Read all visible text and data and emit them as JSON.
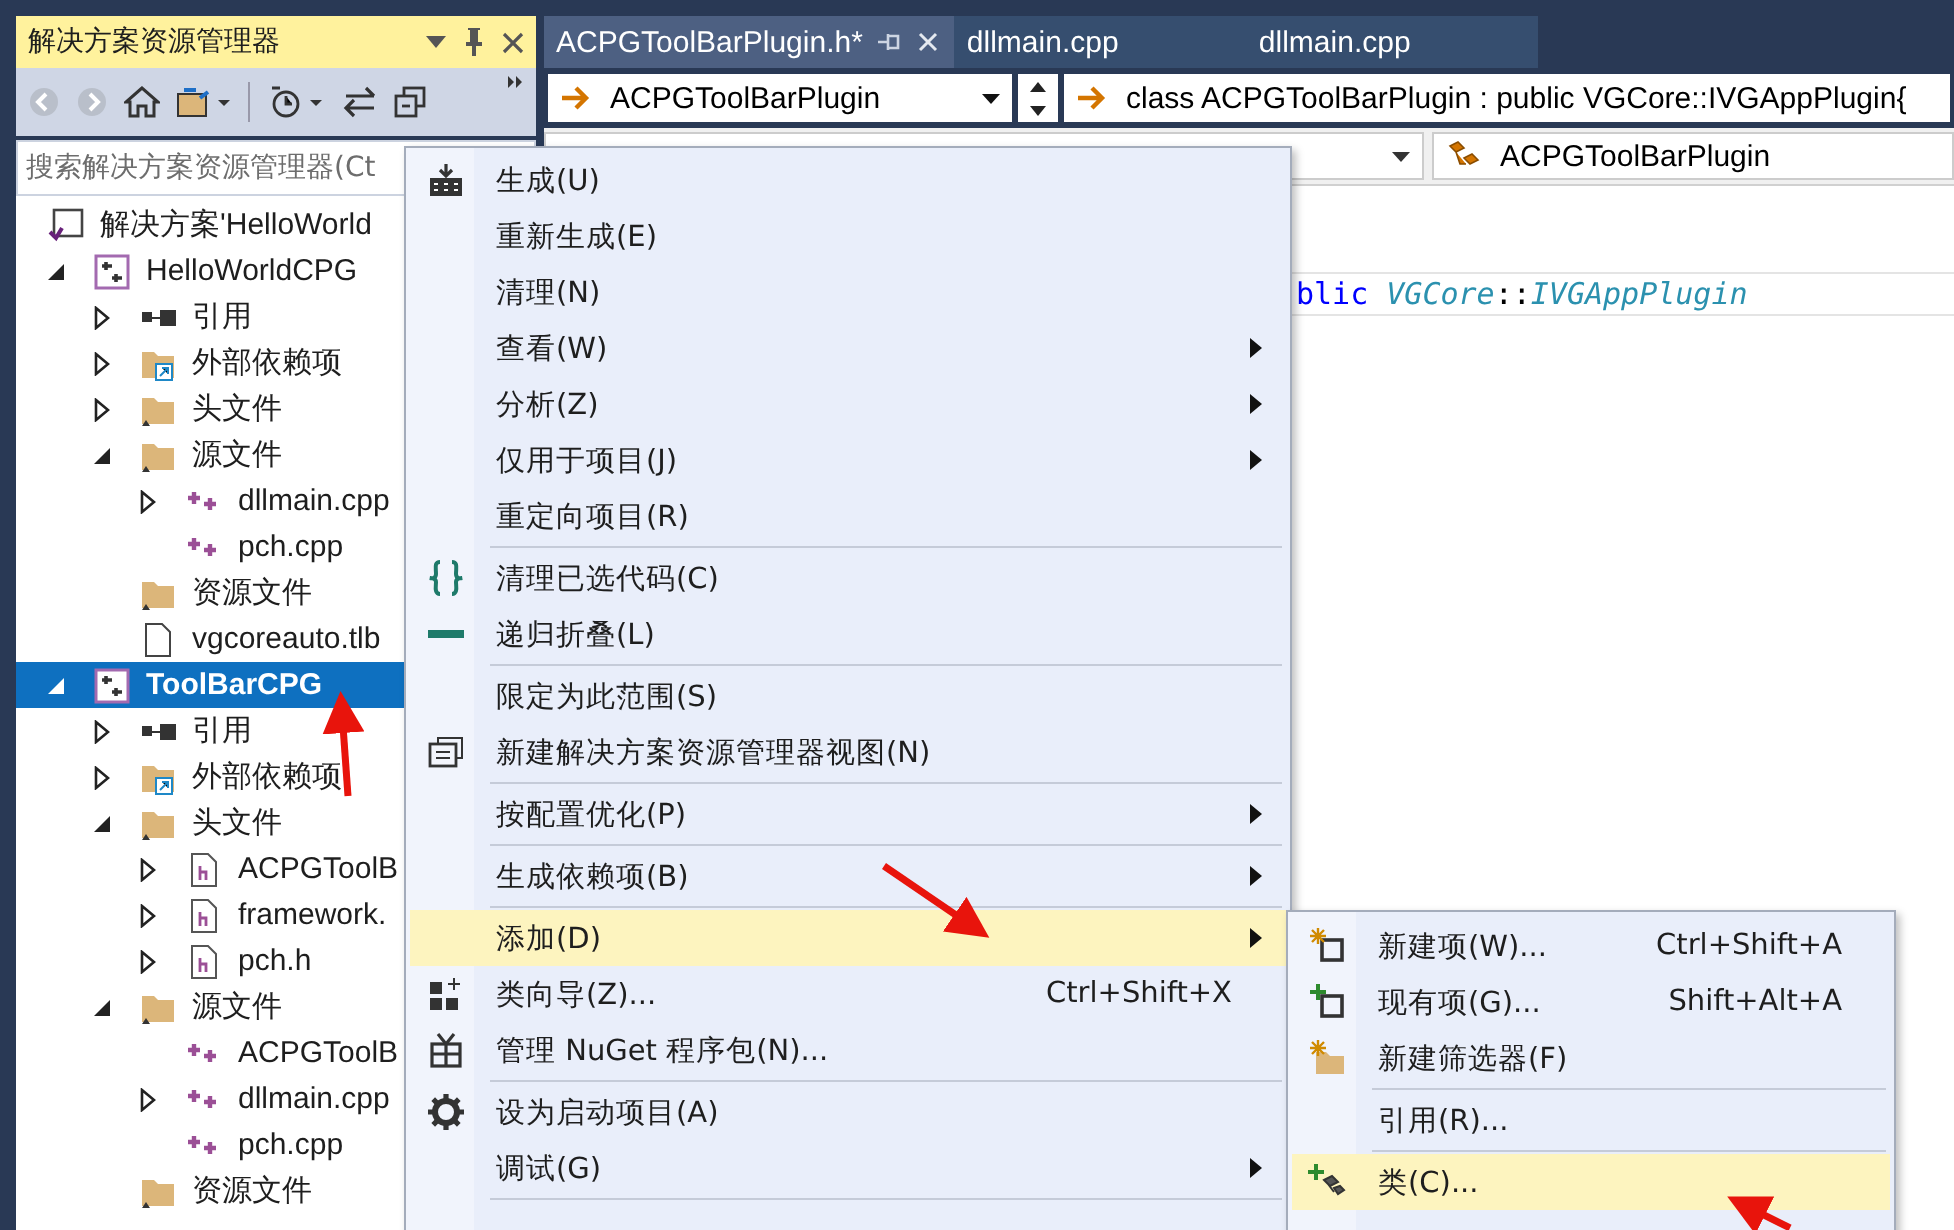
{
  "solution_explorer": {
    "title": "解决方案资源管理器",
    "search": {
      "placeholder": "搜索解决方案资源管理器(Ct"
    },
    "tree": [
      {
        "label": "解决方案'HelloWorld",
        "kind": "solution",
        "selected": false,
        "children": [
          {
            "label": "HelloWorldCPG",
            "kind": "project",
            "selected": false,
            "startup": false,
            "expanded": true,
            "children": [
              {
                "label": "引用",
                "kind": "references",
                "selected": false,
                "expanded": false
              },
              {
                "label": "外部依赖项",
                "kind": "external",
                "selected": false,
                "expanded": false
              },
              {
                "label": "头文件",
                "kind": "folder",
                "selected": false,
                "expanded": false
              },
              {
                "label": "源文件",
                "kind": "folder",
                "selected": false,
                "expanded": true,
                "children": [
                  {
                    "label": "dllmain.cpp",
                    "kind": "cpp",
                    "selected": false,
                    "expanded": false
                  },
                  {
                    "label": "pch.cpp",
                    "kind": "cpp",
                    "selected": false
                  }
                ]
              },
              {
                "label": "资源文件",
                "kind": "folder",
                "selected": false
              },
              {
                "label": "vgcoreauto.tlb",
                "kind": "file",
                "selected": false
              }
            ]
          },
          {
            "label": "ToolBarCPG",
            "kind": "project",
            "selected": true,
            "startup": true,
            "expanded": true,
            "children": [
              {
                "label": "引用",
                "kind": "references",
                "selected": false,
                "expanded": false
              },
              {
                "label": "外部依赖项",
                "kind": "external",
                "selected": false,
                "expanded": false
              },
              {
                "label": "头文件",
                "kind": "folder",
                "selected": false,
                "expanded": true,
                "children": [
                  {
                    "label": "ACPGToolB",
                    "kind": "header",
                    "selected": false,
                    "expanded": false
                  },
                  {
                    "label": "framework.",
                    "kind": "header",
                    "selected": false,
                    "expanded": false
                  },
                  {
                    "label": "pch.h",
                    "kind": "header",
                    "selected": false,
                    "expanded": false
                  }
                ]
              },
              {
                "label": "源文件",
                "kind": "folder",
                "selected": false,
                "expanded": true,
                "children": [
                  {
                    "label": "ACPGToolB",
                    "kind": "cpp",
                    "selected": false
                  },
                  {
                    "label": "dllmain.cpp",
                    "kind": "cpp",
                    "selected": false,
                    "expanded": false
                  },
                  {
                    "label": "pch.cpp",
                    "kind": "cpp",
                    "selected": false
                  }
                ]
              },
              {
                "label": "资源文件",
                "kind": "folder",
                "selected": false
              }
            ]
          }
        ]
      }
    ]
  },
  "editor": {
    "tabs": [
      {
        "label": "ACPGToolBarPlugin.h*",
        "selected": true
      },
      {
        "label": "dllmain.cpp",
        "selected": false
      },
      {
        "label": "dllmain.cpp",
        "selected": false
      }
    ],
    "navigation": {
      "type_dropdown": "ACPGToolBarPlugin",
      "member_dropdown": "class ACPGToolBarPlugin : public VGCore::IVGAppPlugin{",
      "scope_dropdown": "ACPGToolBarPlugin"
    },
    "code_line": [
      {
        "text": "blic ",
        "kind": "keyword"
      },
      {
        "text": "VGCore",
        "kind": "namespace"
      },
      {
        "text": "::",
        "kind": "plain"
      },
      {
        "text": "IVGAppPlugin",
        "kind": "type"
      }
    ]
  },
  "context_menu": {
    "items": [
      {
        "kind": "item",
        "label": "生成(U)",
        "selected": false
      },
      {
        "kind": "item",
        "label": "重新生成(E)",
        "selected": false
      },
      {
        "kind": "item",
        "label": "清理(N)",
        "selected": false
      },
      {
        "kind": "item",
        "label": "查看(W)",
        "selected": false,
        "submenu": true
      },
      {
        "kind": "item",
        "label": "分析(Z)",
        "selected": false,
        "submenu": true
      },
      {
        "kind": "item",
        "label": "仅用于项目(J)",
        "selected": false,
        "submenu": true
      },
      {
        "kind": "item",
        "label": "重定向项目(R)",
        "selected": false
      },
      {
        "kind": "separator"
      },
      {
        "kind": "item",
        "label": "清理已选代码(C)",
        "selected": false
      },
      {
        "kind": "item",
        "label": "递归折叠(L)",
        "selected": false
      },
      {
        "kind": "separator"
      },
      {
        "kind": "item",
        "label": "限定为此范围(S)",
        "selected": false
      },
      {
        "kind": "item",
        "label": "新建解决方案资源管理器视图(N)",
        "selected": false
      },
      {
        "kind": "separator"
      },
      {
        "kind": "item",
        "label": "按配置优化(P)",
        "selected": false,
        "submenu": true
      },
      {
        "kind": "separator"
      },
      {
        "kind": "item",
        "label": "生成依赖项(B)",
        "selected": false,
        "submenu": true
      },
      {
        "kind": "separator"
      },
      {
        "kind": "item",
        "label": "添加(D)",
        "selected": true,
        "submenu": true
      },
      {
        "kind": "item",
        "label": "类向导(Z)...",
        "shortcut": "Ctrl+Shift+X",
        "selected": false
      },
      {
        "kind": "item",
        "label": "管理 NuGet 程序包(N)...",
        "selected": false
      },
      {
        "kind": "separator"
      },
      {
        "kind": "item",
        "label": "设为启动项目(A)",
        "selected": false
      },
      {
        "kind": "item",
        "label": "调试(G)",
        "selected": false,
        "submenu": true
      },
      {
        "kind": "separator"
      }
    ]
  },
  "add_submenu": {
    "items": [
      {
        "kind": "item",
        "label": "新建项(W)...",
        "shortcut": "Ctrl+Shift+A",
        "selected": false
      },
      {
        "kind": "item",
        "label": "现有项(G)...",
        "shortcut": "Shift+Alt+A",
        "selected": false
      },
      {
        "kind": "item",
        "label": "新建筛选器(F)",
        "selected": false
      },
      {
        "kind": "separator"
      },
      {
        "kind": "item",
        "label": "引用(R)...",
        "selected": false
      },
      {
        "kind": "separator"
      },
      {
        "kind": "item",
        "label": "类(C)...",
        "selected": true
      }
    ]
  }
}
